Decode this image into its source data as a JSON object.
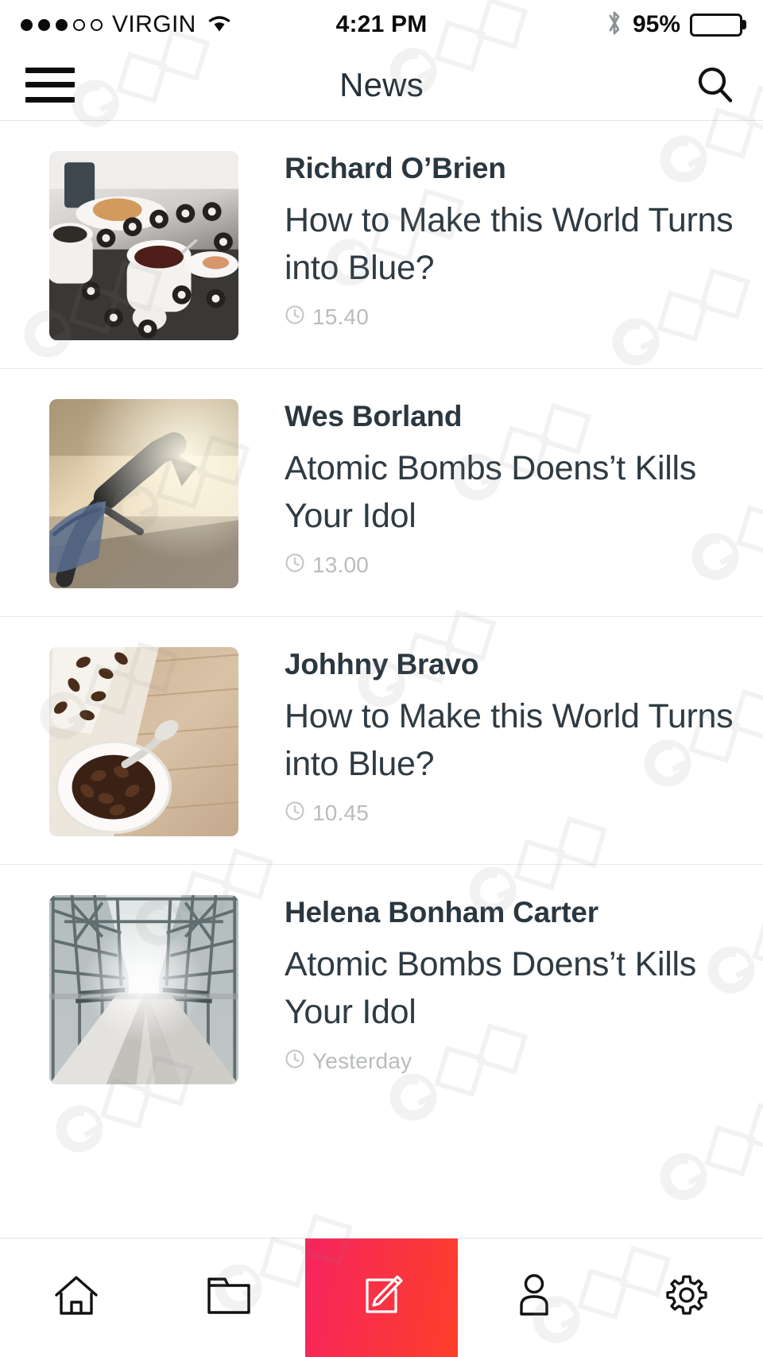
{
  "status_bar": {
    "carrier": "VIRGIN",
    "signal_dots_total": 5,
    "signal_dots_filled": 3,
    "wifi_icon": "wifi-icon",
    "time": "4:21 PM",
    "bluetooth_icon": "bluetooth-icon",
    "battery_percent": "95%",
    "battery_level": 95
  },
  "nav_bar": {
    "menu_icon": "hamburger-menu-icon",
    "title": "News",
    "search_icon": "search-icon"
  },
  "colors": {
    "title": "#26323a",
    "author": "#2a3740",
    "headline": "#2f3b43",
    "timestamp": "#b9bcbd",
    "divider": "#e8e8e8",
    "compose_gradient_start": "#f5245f",
    "compose_gradient_end": "#fd3f2a"
  },
  "news": [
    {
      "author": "Richard O’Brien",
      "headline": "How to Make this World Turns into Blue?",
      "time": "15.40",
      "clock_icon": "clock-icon",
      "thumbnail": "coffee-cups-on-table-photo"
    },
    {
      "author": "Wes Borland",
      "headline": "Atomic Bombs Doens’t Kills Your Idol",
      "time": "13.00",
      "clock_icon": "clock-icon",
      "thumbnail": "high-heel-shoes-photo"
    },
    {
      "author": "Johhny Bravo",
      "headline": "How to Make this World Turns into Blue?",
      "time": "10.45",
      "clock_icon": "clock-icon",
      "thumbnail": "coffee-beans-bowl-photo"
    },
    {
      "author": "Helena Bonham Carter",
      "headline": "Atomic Bombs Doens’t Kills Your Idol",
      "time": "Yesterday",
      "clock_icon": "clock-icon",
      "thumbnail": "steel-bridge-photo"
    }
  ],
  "tab_bar": {
    "items": [
      {
        "name": "home",
        "icon": "home-icon",
        "active": false
      },
      {
        "name": "folder",
        "icon": "folder-icon",
        "active": false
      },
      {
        "name": "compose",
        "icon": "compose-pencil-icon",
        "active": true
      },
      {
        "name": "profile",
        "icon": "person-icon",
        "active": false
      },
      {
        "name": "settings",
        "icon": "gear-icon",
        "active": false
      }
    ]
  }
}
